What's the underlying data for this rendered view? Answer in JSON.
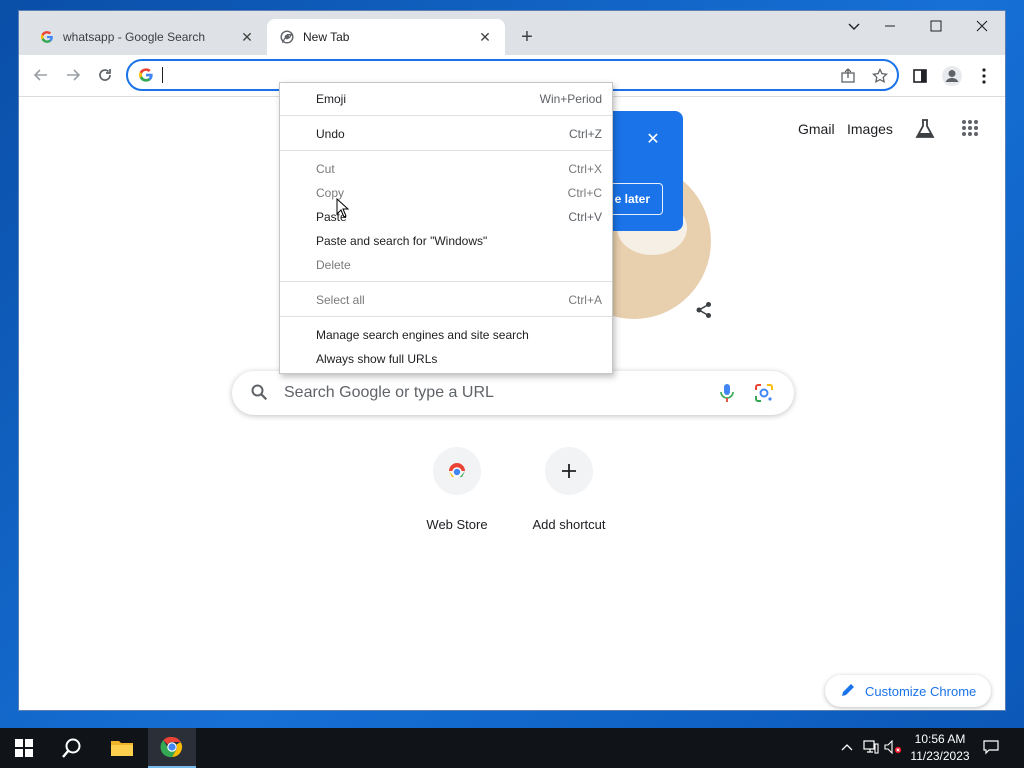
{
  "browser": {
    "tabs": [
      {
        "title": "whatsapp - Google Search",
        "favicon": "google-g-icon",
        "active": false
      },
      {
        "title": "New Tab",
        "favicon": "chrome-icon",
        "active": true
      }
    ],
    "new_tab_symbol": "+",
    "window_controls": {
      "minimize": "—",
      "maximize": "☐",
      "close": "✕"
    },
    "address_bar": {
      "value": ""
    }
  },
  "ntp": {
    "top_links": {
      "gmail": "Gmail",
      "images": "Images"
    },
    "promo": {
      "close_symbol": "✕",
      "button_label": "e later"
    },
    "search": {
      "placeholder": "Search Google or type a URL"
    },
    "shortcuts": [
      {
        "label": "Web Store",
        "icon": "chrome-webstore-icon"
      },
      {
        "label": "Add shortcut",
        "icon": "plus-icon",
        "symbol": "+"
      }
    ],
    "customize_label": "Customize Chrome"
  },
  "context_menu": {
    "items": [
      {
        "label": "Emoji",
        "shortcut": "Win+Period",
        "enabled": true
      },
      {
        "label": "Undo",
        "shortcut": "Ctrl+Z",
        "enabled": true
      },
      {
        "label": "Cut",
        "shortcut": "Ctrl+X",
        "enabled": false
      },
      {
        "label": "Copy",
        "shortcut": "Ctrl+C",
        "enabled": false
      },
      {
        "label": "Paste",
        "shortcut": "Ctrl+V",
        "enabled": true
      },
      {
        "label": "Paste and search for \"Windows\"",
        "shortcut": "",
        "enabled": true
      },
      {
        "label": "Delete",
        "shortcut": "",
        "enabled": false
      },
      {
        "label": "Select all",
        "shortcut": "Ctrl+A",
        "enabled": false
      },
      {
        "label": "Manage search engines and site search",
        "shortcut": "",
        "enabled": true
      },
      {
        "label": "Always show full URLs",
        "shortcut": "",
        "enabled": true
      }
    ]
  },
  "taskbar": {
    "items": [
      "windows-start-icon",
      "search-icon",
      "file-explorer-icon",
      "chrome-icon"
    ],
    "tray": [
      "chevron-up-icon",
      "network-icon",
      "volume-muted-icon"
    ],
    "time": "10:56 AM",
    "date": "11/23/2023"
  },
  "colors": {
    "accent": "#1a73e8",
    "desktop": "#0d5ab5",
    "taskbar": "#101418"
  }
}
